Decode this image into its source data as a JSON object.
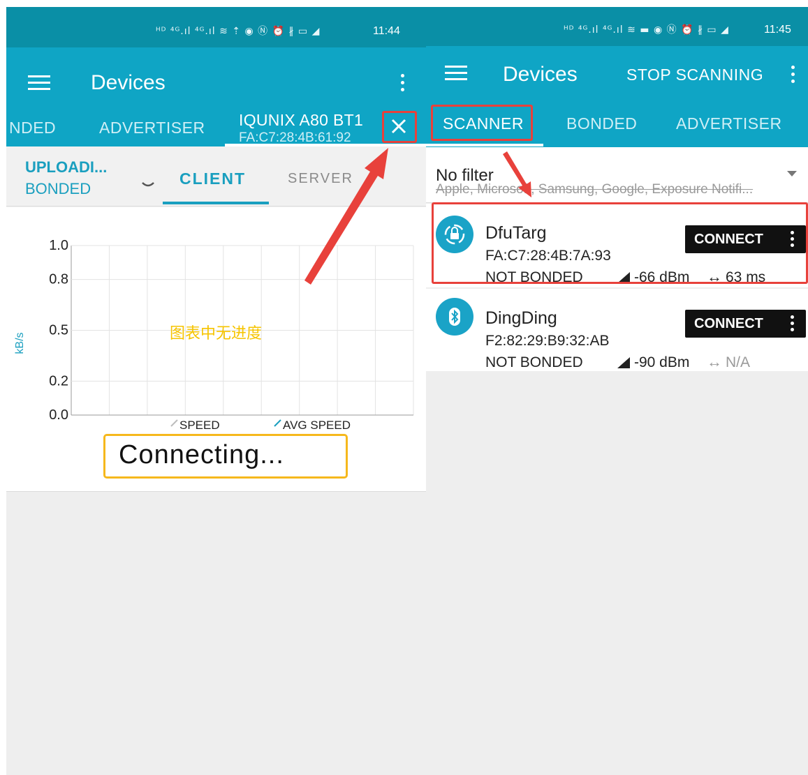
{
  "left_screen": {
    "status_icons": "ᴴᴰ ⁴ᴳ.ıl ⁴ᴳ.ıl ≋ ⇡   ◉ Ⓝ ⏰ ∦ ▭ ◢",
    "status_time": "11:44",
    "appbar": {
      "title": "Devices"
    },
    "tabs": [
      {
        "label": "NDED"
      },
      {
        "label": "ADVERTISER"
      }
    ],
    "active_tab": {
      "name": "IQUNIX A80 BT1",
      "address": "FA:C7:28:4B:61:92"
    },
    "subtabs": {
      "status_line1": "UPLOADI...",
      "status_line2": "BONDED",
      "client": "CLIENT",
      "server": "SERVER"
    },
    "chart_overlay_text": "图表中无进度",
    "connecting_text": "Connecting..."
  },
  "chart_data": {
    "type": "line",
    "title": "",
    "xlabel": "",
    "ylabel": "kB/s",
    "ylim": [
      0,
      1.0
    ],
    "y_ticks": [
      "0.0",
      "0.2",
      "0.5",
      "0.8",
      "1.0"
    ],
    "grid": true,
    "series": [
      {
        "name": "SPEED",
        "values": []
      },
      {
        "name": "AVG SPEED",
        "values": []
      }
    ],
    "legend": "bottom"
  },
  "right_screen": {
    "status_icons": "ᴴᴰ ⁴ᴳ.ıl ⁴ᴳ.ıl ≋ ▬  ◉ Ⓝ ⏰ ∦ ▭ ◢",
    "status_time": "11:45",
    "appbar": {
      "title": "Devices",
      "stop_scanning": "STOP SCANNING"
    },
    "tabs": [
      {
        "label": "SCANNER"
      },
      {
        "label": "BONDED"
      },
      {
        "label": "ADVERTISER"
      }
    ],
    "filter": {
      "title": "No filter",
      "subtitle": "Apple, Microsoft, Samsung, Google, Exposure Notifi..."
    },
    "devices": [
      {
        "name": "DfuTarg",
        "address": "FA:C7:28:4B:7A:93",
        "bond": "NOT BONDED",
        "rssi": "-66 dBm",
        "interval": "63 ms",
        "connect_label": "CONNECT",
        "icon": "dfu-icon"
      },
      {
        "name": "DingDing",
        "address": "F2:82:29:B9:32:AB",
        "bond": "NOT BONDED",
        "rssi": "-90 dBm",
        "interval": "N/A",
        "connect_label": "CONNECT",
        "icon": "bluetooth-icon"
      }
    ]
  },
  "colors": {
    "status_bar": "#0a8fa6",
    "app_bar": "#0fa5c5",
    "accent": "#1a9fbf",
    "annotation_red": "#e8413b",
    "annotation_yellow": "#f6b81c"
  }
}
